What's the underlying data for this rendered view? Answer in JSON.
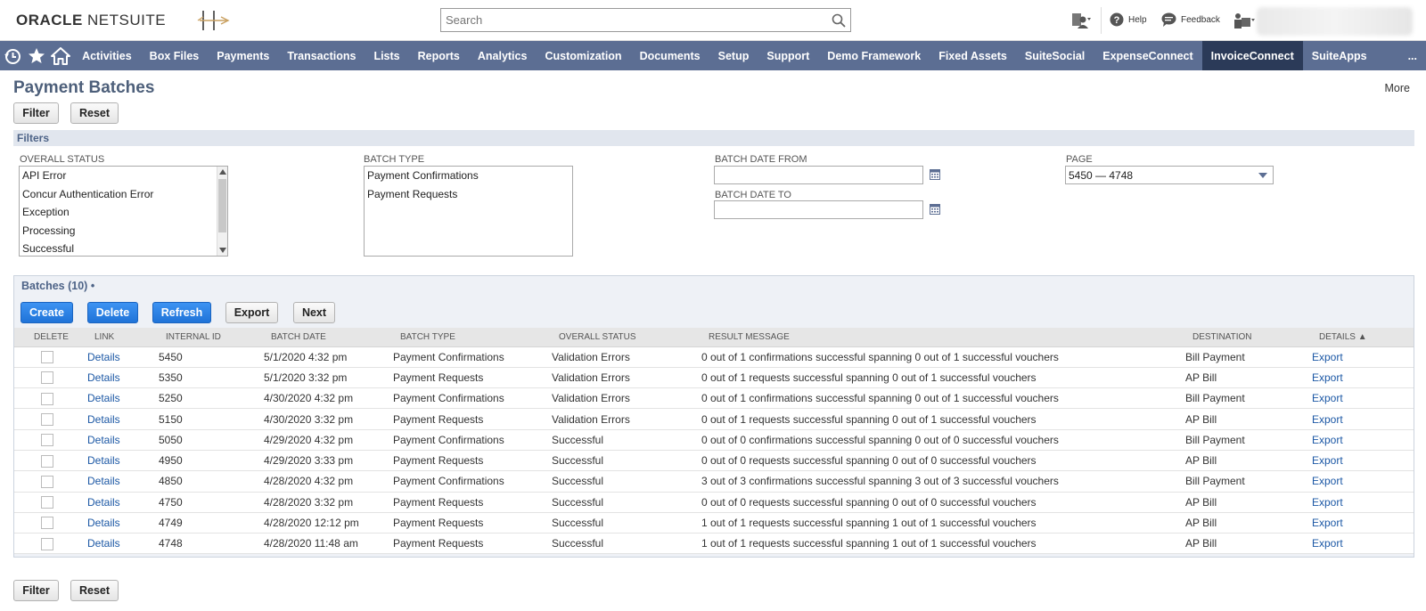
{
  "header": {
    "logo_bold": "ORACLE",
    "logo_light": " NETSUITE",
    "search_placeholder": "Search",
    "help_label": "Help",
    "feedback_label": "Feedback"
  },
  "nav": {
    "items": [
      {
        "label": "Activities"
      },
      {
        "label": "Box Files"
      },
      {
        "label": "Payments"
      },
      {
        "label": "Transactions"
      },
      {
        "label": "Lists"
      },
      {
        "label": "Reports"
      },
      {
        "label": "Analytics"
      },
      {
        "label": "Customization"
      },
      {
        "label": "Documents"
      },
      {
        "label": "Setup"
      },
      {
        "label": "Support"
      },
      {
        "label": "Demo Framework"
      },
      {
        "label": "Fixed Assets"
      },
      {
        "label": "SuiteSocial"
      },
      {
        "label": "ExpenseConnect"
      },
      {
        "label": "InvoiceConnect"
      },
      {
        "label": "SuiteApps"
      },
      {
        "label": "..."
      }
    ],
    "active": "InvoiceConnect"
  },
  "page": {
    "title": "Payment Batches",
    "more": "More",
    "filter_label": "Filter",
    "reset_label": "Reset"
  },
  "filters": {
    "section_title": "Filters",
    "overall_status_label": "OVERALL STATUS",
    "overall_status_options": [
      "API Error",
      "Concur Authentication Error",
      "Exception",
      "Processing",
      "Successful"
    ],
    "batch_type_label": "BATCH TYPE",
    "batch_type_options": [
      "Payment Confirmations",
      "Payment Requests"
    ],
    "batch_date_from_label": "BATCH DATE FROM",
    "batch_date_to_label": "BATCH DATE TO",
    "page_label": "PAGE",
    "page_value": "5450 — 4748"
  },
  "batches": {
    "title": "Batches (10)",
    "create_label": "Create",
    "delete_label": "Delete",
    "refresh_label": "Refresh",
    "export_label": "Export",
    "next_label": "Next",
    "columns": [
      "DELETE",
      "LINK",
      "INTERNAL ID",
      "BATCH DATE",
      "BATCH TYPE",
      "OVERALL STATUS",
      "RESULT MESSAGE",
      "DESTINATION",
      "DETAILS ▲"
    ],
    "rows": [
      {
        "link": "Details",
        "id": "5450",
        "date": "5/1/2020 4:32 pm",
        "type": "Payment Confirmations",
        "status": "Validation Errors",
        "message": "0 out of 1 confirmations successful spanning 0 out of 1 successful vouchers",
        "destination": "Bill Payment",
        "details": "Export"
      },
      {
        "link": "Details",
        "id": "5350",
        "date": "5/1/2020 3:32 pm",
        "type": "Payment Requests",
        "status": "Validation Errors",
        "message": "0 out of 1 requests successful spanning 0 out of 1 successful vouchers",
        "destination": "AP Bill",
        "details": "Export"
      },
      {
        "link": "Details",
        "id": "5250",
        "date": "4/30/2020 4:32 pm",
        "type": "Payment Confirmations",
        "status": "Validation Errors",
        "message": "0 out of 1 confirmations successful spanning 0 out of 1 successful vouchers",
        "destination": "Bill Payment",
        "details": "Export"
      },
      {
        "link": "Details",
        "id": "5150",
        "date": "4/30/2020 3:32 pm",
        "type": "Payment Requests",
        "status": "Validation Errors",
        "message": "0 out of 1 requests successful spanning 0 out of 1 successful vouchers",
        "destination": "AP Bill",
        "details": "Export"
      },
      {
        "link": "Details",
        "id": "5050",
        "date": "4/29/2020 4:32 pm",
        "type": "Payment Confirmations",
        "status": "Successful",
        "message": "0 out of 0 confirmations successful spanning 0 out of 0 successful vouchers",
        "destination": "Bill Payment",
        "details": "Export"
      },
      {
        "link": "Details",
        "id": "4950",
        "date": "4/29/2020 3:33 pm",
        "type": "Payment Requests",
        "status": "Successful",
        "message": "0 out of 0 requests successful spanning 0 out of 0 successful vouchers",
        "destination": "AP Bill",
        "details": "Export"
      },
      {
        "link": "Details",
        "id": "4850",
        "date": "4/28/2020 4:32 pm",
        "type": "Payment Confirmations",
        "status": "Successful",
        "message": "3 out of 3 confirmations successful spanning 3 out of 3 successful vouchers",
        "destination": "Bill Payment",
        "details": "Export"
      },
      {
        "link": "Details",
        "id": "4750",
        "date": "4/28/2020 3:32 pm",
        "type": "Payment Requests",
        "status": "Successful",
        "message": "0 out of 0 requests successful spanning 0 out of 0 successful vouchers",
        "destination": "AP Bill",
        "details": "Export"
      },
      {
        "link": "Details",
        "id": "4749",
        "date": "4/28/2020 12:12 pm",
        "type": "Payment Requests",
        "status": "Successful",
        "message": "1 out of 1 requests successful spanning 1 out of 1 successful vouchers",
        "destination": "AP Bill",
        "details": "Export"
      },
      {
        "link": "Details",
        "id": "4748",
        "date": "4/28/2020 11:48 am",
        "type": "Payment Requests",
        "status": "Successful",
        "message": "1 out of 1 requests successful spanning 1 out of 1 successful vouchers",
        "destination": "AP Bill",
        "details": "Export"
      }
    ]
  },
  "colors": {
    "nav_bg": "#5c6e93",
    "nav_active": "#2b3a58",
    "title_color": "#4d5f7a",
    "link_color": "#1c58a5",
    "button_blue": "#1f73d8"
  }
}
